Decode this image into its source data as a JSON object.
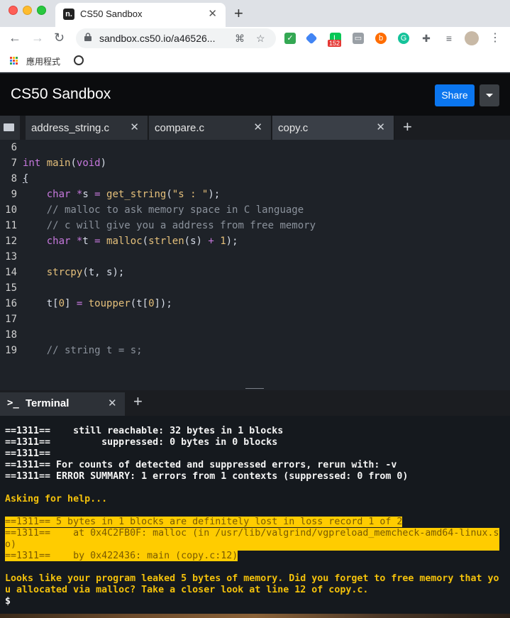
{
  "browser": {
    "tab_title": "CS50 Sandbox",
    "favicon_letter": "n.",
    "url": "sandbox.cs50.io/a46526...",
    "bookmark_label": "應用程式",
    "badge_count": "152"
  },
  "header": {
    "title": "CS50 Sandbox",
    "share_label": "Share"
  },
  "editor_tabs": [
    {
      "label": "address_string.c"
    },
    {
      "label": "compare.c"
    },
    {
      "label": "copy.c"
    }
  ],
  "code": {
    "line_numbers": [
      "6",
      "7",
      "8",
      "9",
      "10",
      "11",
      "12",
      "13",
      "14",
      "15",
      "16",
      "17",
      "18",
      "19"
    ],
    "comment1": "// malloc to ask memory space in C language",
    "comment2": "// c will give you a address from free memory",
    "comment3": "// string t = s;"
  },
  "terminal": {
    "tab_label": "Terminal",
    "prompt_symbol": ">_",
    "lines": [
      "==1311==    still reachable: 32 bytes in 1 blocks",
      "==1311==         suppressed: 0 bytes in 0 blocks",
      "==1311==",
      "==1311== For counts of detected and suppressed errors, rerun with: -v",
      "==1311== ERROR SUMMARY: 1 errors from 1 contexts (suppressed: 0 from 0)"
    ],
    "help_label": "Asking for help...",
    "hl_line1": "==1311== 5 bytes in 1 blocks are definitely lost in loss record 1 of 2",
    "hl_line2": "==1311==    at 0x4C2FB0F: malloc (in /usr/lib/valgrind/vgpreload_memcheck-amd64-linux.so)",
    "hl_line3": "==1311==    by 0x422436: main (copy.c:12)",
    "advice": "Looks like your program leaked 5 bytes of memory. Did you forget to free memory that you allocated via malloc? Take a closer look at line 12 of copy.c.",
    "prompt": "$"
  },
  "colors": {
    "share_button": "#0b76ef",
    "highlight": "#ffcc00",
    "help_text": "#f3c10b"
  }
}
